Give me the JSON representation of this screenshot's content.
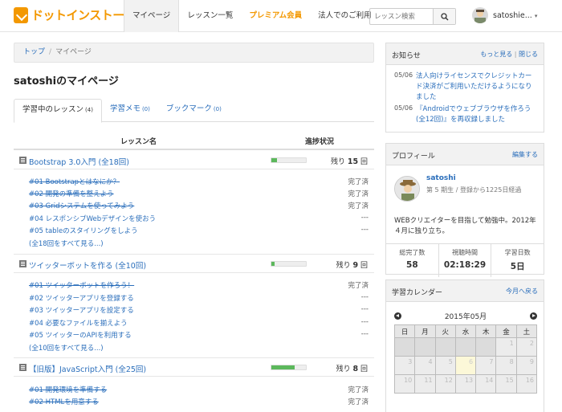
{
  "header": {
    "logo_text": "ドットインストール",
    "nav": [
      {
        "label": "マイページ",
        "active": true
      },
      {
        "label": "レッスン一覧"
      },
      {
        "label": "プレミアム会員",
        "premium": true
      },
      {
        "label": "法人でのご利用"
      }
    ],
    "search_placeholder": "レッスン検索",
    "user_name": "satoshie...",
    "user_caret": "▾"
  },
  "breadcrumb": {
    "home": "トップ",
    "separator": "/",
    "current": "マイページ"
  },
  "page_title": "satoshiのマイページ",
  "tabs": [
    {
      "label": "学習中のレッスン",
      "count": "(4)",
      "active": true
    },
    {
      "label": "学習メモ",
      "count": "(0)"
    },
    {
      "label": "ブックマーク",
      "count": "(0)"
    }
  ],
  "lesson_table": {
    "col_name": "レッスン名",
    "col_progress": "進捗状況"
  },
  "courses": [
    {
      "title": "Bootstrap 3.0入門 (全18回)",
      "remain_prefix": "残り",
      "remain": "15",
      "remain_suffix": "回",
      "progress": 0.167,
      "lessons": [
        {
          "title": "#01 Bootstrapとはなにか？",
          "status": "完了済",
          "done": true
        },
        {
          "title": "#02 開発の準備を整えよう",
          "status": "完了済",
          "done": true
        },
        {
          "title": "#03 Gridシステムを使ってみよう",
          "status": "完了済",
          "done": true
        },
        {
          "title": "#04 レスポンシブWebデザインを使おう",
          "status": "---",
          "done": false
        },
        {
          "title": "#05 tableのスタイリングをしよう",
          "status": "---",
          "done": false
        }
      ],
      "more": "(全18回をすべて見る...)"
    },
    {
      "title": "ツイッターボットを作る (全10回)",
      "remain_prefix": "残り",
      "remain": "9",
      "remain_suffix": "回",
      "progress": 0.1,
      "lessons": [
        {
          "title": "#01 ツイッターボットを作ろう！",
          "status": "完了済",
          "done": true
        },
        {
          "title": "#02 ツイッターアプリを登録する",
          "status": "---",
          "done": false
        },
        {
          "title": "#03 ツイッターアプリを設定する",
          "status": "---",
          "done": false
        },
        {
          "title": "#04 必要なファイルを揃えよう",
          "status": "---",
          "done": false
        },
        {
          "title": "#05 ツイッターのAPIを利用する",
          "status": "---",
          "done": false
        }
      ],
      "more": "(全10回をすべて見る...)"
    },
    {
      "title": "【旧版】JavaScript入門 (全25回)",
      "remain_prefix": "残り",
      "remain": "8",
      "remain_suffix": "回",
      "progress": 0.68,
      "lessons": [
        {
          "title": "#01 開発環境を準備する",
          "status": "完了済",
          "done": true
        },
        {
          "title": "#02 HTMLを用意する",
          "status": "完了済",
          "done": true
        }
      ]
    }
  ],
  "news": {
    "title": "お知らせ",
    "link_more": "もっと見る",
    "link_sep": "|",
    "link_close": "閉じる",
    "items": [
      {
        "date": "05/06",
        "text": "法人向けライセンスでクレジットカード決済がご利用いただけるようになりました"
      },
      {
        "date": "05/06",
        "text": "『Androidでウェブブラウザを作ろう (全12回)』を再収録しました"
      }
    ]
  },
  "profile": {
    "title": "プロフィール",
    "edit": "編集する",
    "name": "satoshi",
    "meta": "第 5 期生 / 登録から1225日経過",
    "bio": "WEBクリエイターを目指して勉強中。2012年４月に独り立ち。",
    "stats": [
      {
        "label": "総完了数",
        "value": "58"
      },
      {
        "label": "視聴時間",
        "value": "02:18:29"
      },
      {
        "label": "学習日数",
        "value": "5日"
      }
    ]
  },
  "calendar": {
    "title": "学習カレンダー",
    "today_link": "今月へ戻る",
    "month": "2015年05月",
    "weekdays": [
      "日",
      "月",
      "火",
      "水",
      "木",
      "金",
      "土"
    ],
    "rows": [
      [
        "",
        "",
        "",
        "",
        "",
        "1",
        "2"
      ],
      [
        "3",
        "4",
        "5",
        "6",
        "7",
        "8",
        "9"
      ],
      [
        "10",
        "11",
        "12",
        "13",
        "14",
        "15",
        "16"
      ]
    ],
    "today": "6"
  }
}
